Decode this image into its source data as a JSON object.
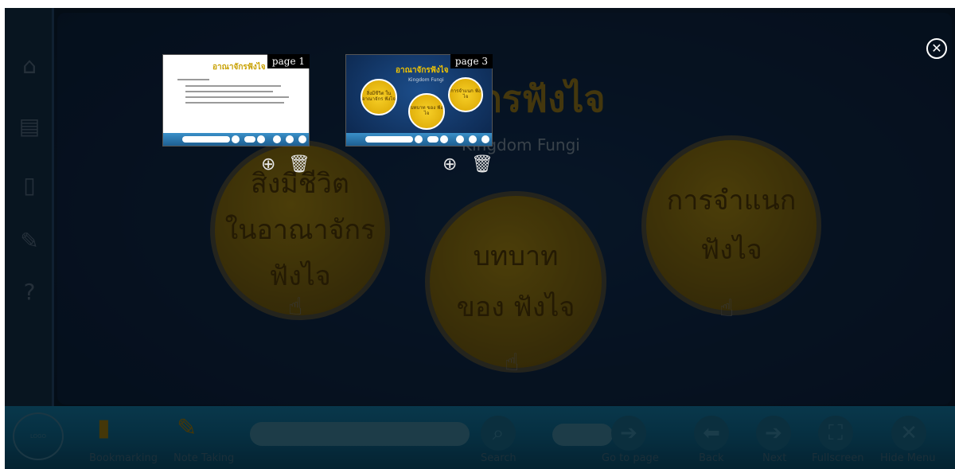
{
  "thumbnails": [
    {
      "label": "page 1",
      "title": "อาณาจักรฟังไจ",
      "zoom_icon": "zoom-in-icon",
      "delete_icon": "trash-icon"
    },
    {
      "label": "page 3",
      "title": "อาณาจักรฟังไจ",
      "subtitle": "Kingdom Fungi",
      "circles": [
        "สิ่งมีชีวิต ในอาณาจักร ฟังไจ",
        "บทบาท ของ ฟังไจ",
        "การจำแนก ฟังไจ"
      ],
      "zoom_icon": "zoom-in-icon",
      "delete_icon": "trash-icon"
    }
  ],
  "slide": {
    "title": "จักรฟังไจ",
    "subtitle": "Kingdom Fungi",
    "circles": [
      {
        "lines": [
          "สิ่งมีชีวิต",
          "ในอาณาจักร",
          "ฟังไจ"
        ]
      },
      {
        "lines": [
          "บทบาท",
          "ของ ฟังไจ"
        ]
      },
      {
        "lines": [
          "การจำแนก",
          "ฟังไจ"
        ]
      }
    ]
  },
  "toolbar": {
    "logo": "LOGO",
    "bookmarking": "Bookmarking",
    "note_taking": "Note Taking",
    "search": "Search",
    "search_placeholder": "",
    "page_placeholder": "",
    "go_to_page": "Go to page",
    "back": "Back",
    "next": "Next",
    "fullscreen": "Fullscreen",
    "hide_menu": "Hide Menu"
  },
  "sidebar": {
    "icons": [
      "home-icon",
      "document-icon",
      "book-icon",
      "edit-icon",
      "help-icon"
    ]
  },
  "colors": {
    "toolbar": "#0a4a66",
    "circle": "#5e4c0d",
    "thumb_bar": "#2a7ab0"
  }
}
